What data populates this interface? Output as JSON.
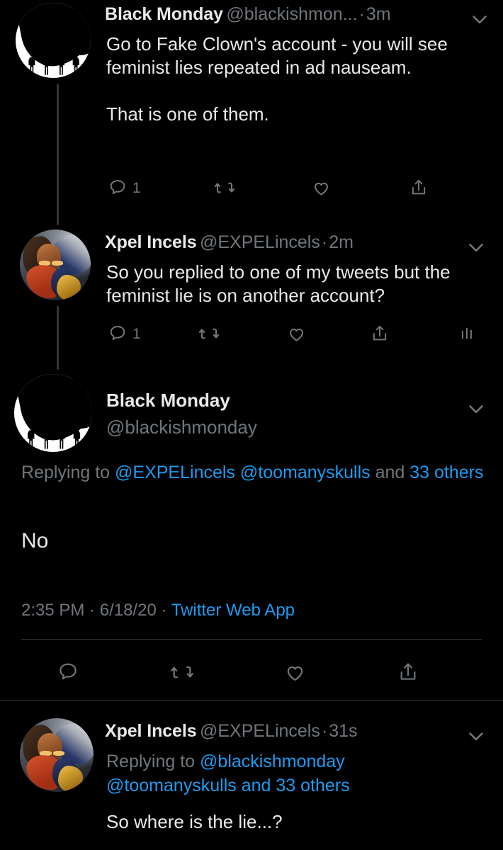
{
  "theme": {
    "background": "#000000",
    "text_primary": "#e7e9ea",
    "text_secondary": "#71767b",
    "link": "#1d9bf0",
    "divider": "#2f3336",
    "thread_line": "#333639"
  },
  "thread": {
    "tweets": [
      {
        "id": "tweet-1",
        "author_name": "Black Monday",
        "author_handle": "@blackishmon...",
        "separator": "·",
        "timestamp": "3m",
        "avatar": "black-monday-avatar",
        "body": "Go to Fake Clown's account - you will see feminist lies repeated in ad nauseam.\n\nThat is one of them.",
        "actions": {
          "reply_count": "1",
          "retweet_count": "",
          "like_count": "",
          "share_count": ""
        }
      },
      {
        "id": "tweet-2",
        "author_name": "Xpel Incels",
        "author_handle": "@EXPELincels",
        "separator": "·",
        "timestamp": "2m",
        "avatar": "xpel-incels-avatar",
        "body": "So you replied to one of my tweets but the feminist lie is on another account?",
        "actions": {
          "reply_count": "1",
          "retweet_count": "",
          "like_count": "",
          "share_count": "",
          "analytics": ""
        }
      }
    ],
    "focused_tweet": {
      "id": "tweet-3-focused",
      "author_name": "Black Monday",
      "author_handle": "@blackishmonday",
      "avatar": "black-monday-avatar",
      "replying_to_prefix": "Replying to ",
      "replying_to_mentions": "@EXPELincels @toomanyskulls",
      "replying_to_and": " and ",
      "replying_to_others": "33 others",
      "body": "No",
      "meta_time": "2:35 PM",
      "meta_sep1": " · ",
      "meta_date": "6/18/20",
      "meta_sep2": " · ",
      "meta_source": "Twitter Web App"
    },
    "last_reply": {
      "id": "tweet-4",
      "author_name": "Xpel Incels",
      "author_handle": "@EXPELincels",
      "separator": "·",
      "timestamp": "31s",
      "avatar": "xpel-incels-avatar",
      "replying_to_prefix": "Replying to ",
      "replying_to_mention1": "@blackishmonday",
      "replying_to_mention2": "@toomanyskulls",
      "replying_to_and": " and ",
      "replying_to_others": "33 others",
      "body": "So where is the lie...?"
    }
  },
  "icons": {
    "reply": "reply-icon",
    "retweet": "retweet-icon",
    "like": "like-icon",
    "share": "share-icon",
    "analytics": "analytics-icon",
    "caret": "chevron-down-icon"
  }
}
